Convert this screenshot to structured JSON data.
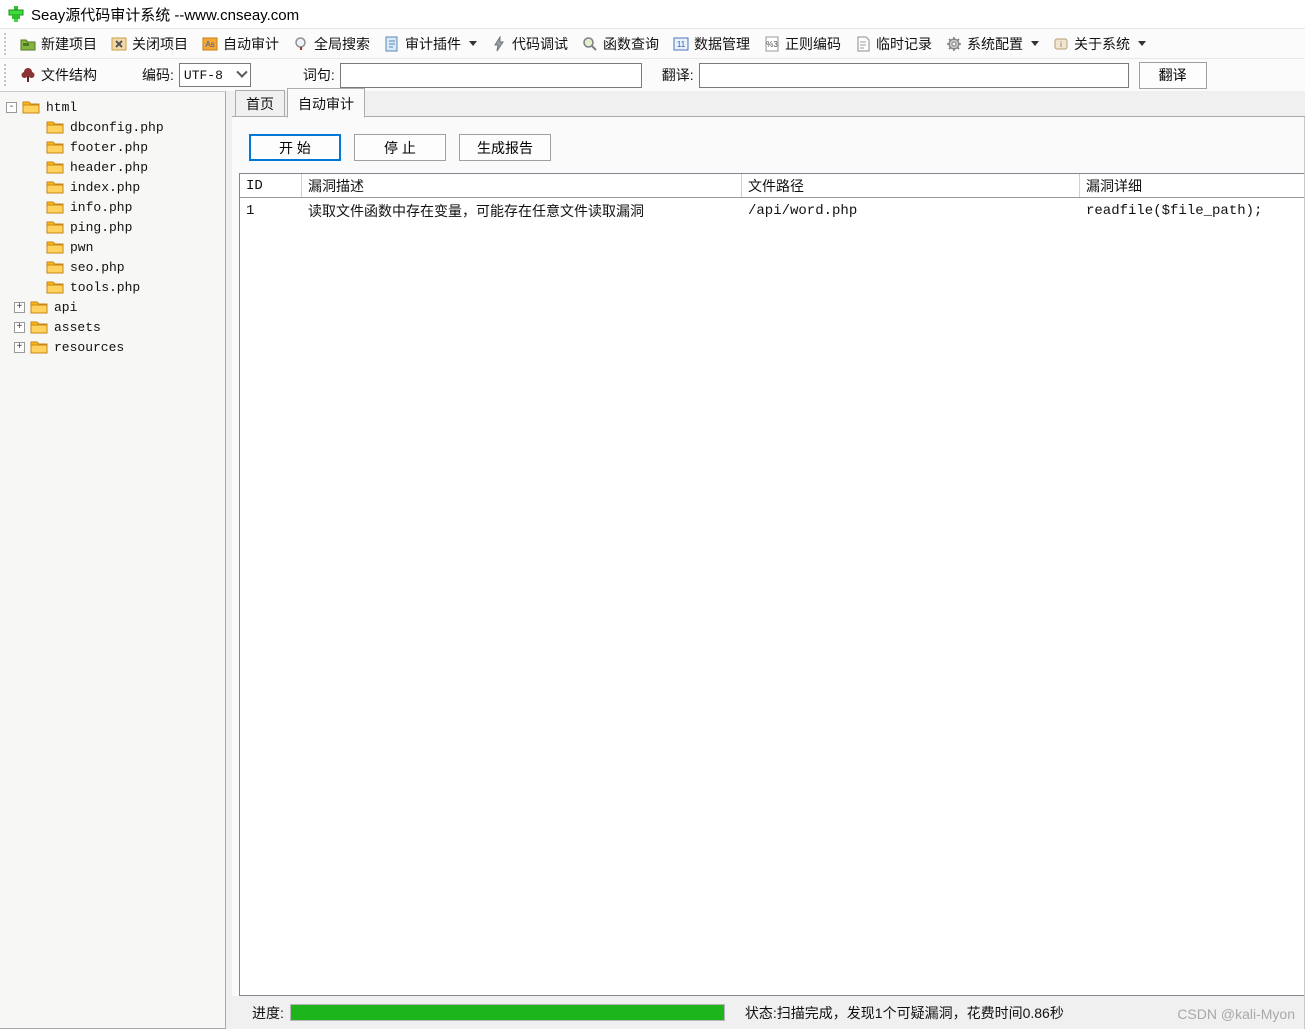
{
  "window": {
    "title": "Seay源代码审计系统  --www.cnseay.com"
  },
  "toolbar": {
    "items": [
      {
        "label": "新建项目",
        "icon": "new-project-folder-icon"
      },
      {
        "label": "关闭项目",
        "icon": "close-project-x-icon"
      },
      {
        "label": "自动审计",
        "icon": "auto-audit-icon"
      },
      {
        "label": "全局搜索",
        "icon": "global-search-magnifier-icon"
      },
      {
        "label": "审计插件",
        "icon": "audit-plugin-icon",
        "dropdown": true
      },
      {
        "label": "代码调试",
        "icon": "code-debug-lightning-icon"
      },
      {
        "label": "函数查询",
        "icon": "function-query-magnifier-icon"
      },
      {
        "label": "数据管理",
        "icon": "data-management-icon"
      },
      {
        "label": "正则编码",
        "icon": "regex-encoding-icon"
      },
      {
        "label": "临时记录",
        "icon": "temp-notes-icon"
      },
      {
        "label": "系统配置",
        "icon": "system-config-gear-icon",
        "dropdown": true
      },
      {
        "label": "关于系统",
        "icon": "about-system-icon",
        "dropdown": true
      }
    ]
  },
  "toolbar2": {
    "file_structure_label": "文件结构",
    "encoding_label": "编码:",
    "encoding_value": "UTF-8",
    "phrase_label": "词句:",
    "phrase_value": "",
    "translate_label": "翻译:",
    "translate_value": "",
    "translate_button": "翻译"
  },
  "tree": {
    "items": [
      {
        "label": "html",
        "depth": 0,
        "expander": "-"
      },
      {
        "label": "dbconfig.php",
        "depth": 1
      },
      {
        "label": "footer.php",
        "depth": 1
      },
      {
        "label": "header.php",
        "depth": 1
      },
      {
        "label": "index.php",
        "depth": 1
      },
      {
        "label": "info.php",
        "depth": 1
      },
      {
        "label": "ping.php",
        "depth": 1
      },
      {
        "label": "pwn",
        "depth": 1
      },
      {
        "label": "seo.php",
        "depth": 1
      },
      {
        "label": "tools.php",
        "depth": 1
      },
      {
        "label": "api",
        "depth": 1,
        "expander": "+"
      },
      {
        "label": "assets",
        "depth": 1,
        "expander": "+"
      },
      {
        "label": "resources",
        "depth": 1,
        "expander": "+"
      }
    ]
  },
  "tabs": [
    {
      "label": "首页",
      "active": false
    },
    {
      "label": "自动审计",
      "active": true
    }
  ],
  "audit_panel": {
    "start_button": "开 始",
    "stop_button": "停 止",
    "report_button": "生成报告"
  },
  "vuln_table": {
    "headers": [
      "ID",
      "漏洞描述",
      "文件路径",
      "漏洞详细"
    ],
    "rows": [
      {
        "id": "1",
        "description": "读取文件函数中存在变量，可能存在任意文件读取漏洞",
        "file_path": "/api/word.php",
        "detail": "readfile($file_path);"
      }
    ]
  },
  "statusbar": {
    "progress_label": "进度:",
    "progress_percent": 100,
    "progress_color": "#1cb51c",
    "status_text": "状态:扫描完成，发现1个可疑漏洞，花费时间0.86秒"
  },
  "watermark": "CSDN @kali-Myon",
  "colors": {
    "accent_blue": "#0078d7",
    "folder_orange": "#fdb813",
    "logo_green": "#3ddc3d"
  }
}
